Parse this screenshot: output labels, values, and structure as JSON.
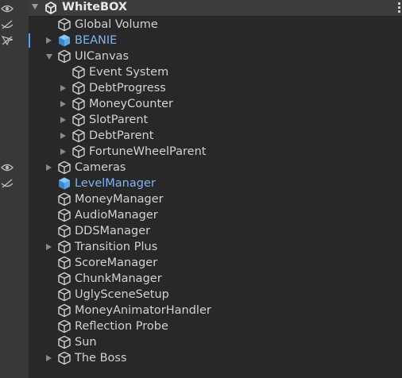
{
  "scene": {
    "title": "WhiteBOX"
  },
  "colors": {
    "background": "#282828",
    "gutter": "#383838",
    "prefab_text": "#7fb4f0",
    "text": "#d2d2d2"
  },
  "items": [
    {
      "label": "Global Volume",
      "depth": 1,
      "foldout": "none",
      "kind": "object"
    },
    {
      "label": "BEANIE",
      "depth": 1,
      "foldout": "closed",
      "kind": "prefab"
    },
    {
      "label": "UICanvas",
      "depth": 1,
      "foldout": "open",
      "kind": "object"
    },
    {
      "label": "Event System",
      "depth": 2,
      "foldout": "none",
      "kind": "object"
    },
    {
      "label": "DebtProgress",
      "depth": 2,
      "foldout": "closed",
      "kind": "object"
    },
    {
      "label": "MoneyCounter",
      "depth": 2,
      "foldout": "closed",
      "kind": "object"
    },
    {
      "label": "SlotParent",
      "depth": 2,
      "foldout": "closed",
      "kind": "object"
    },
    {
      "label": "DebtParent",
      "depth": 2,
      "foldout": "closed",
      "kind": "object"
    },
    {
      "label": "FortuneWheelParent",
      "depth": 2,
      "foldout": "closed",
      "kind": "object"
    },
    {
      "label": "Cameras",
      "depth": 1,
      "foldout": "closed",
      "kind": "object"
    },
    {
      "label": "LevelManager",
      "depth": 1,
      "foldout": "none",
      "kind": "prefab"
    },
    {
      "label": "MoneyManager",
      "depth": 1,
      "foldout": "none",
      "kind": "object"
    },
    {
      "label": "AudioManager",
      "depth": 1,
      "foldout": "none",
      "kind": "object"
    },
    {
      "label": "DDSManager",
      "depth": 1,
      "foldout": "none",
      "kind": "object"
    },
    {
      "label": "Transition Plus",
      "depth": 1,
      "foldout": "closed",
      "kind": "object"
    },
    {
      "label": "ScoreManager",
      "depth": 1,
      "foldout": "none",
      "kind": "object"
    },
    {
      "label": "ChunkManager",
      "depth": 1,
      "foldout": "none",
      "kind": "object"
    },
    {
      "label": "UglySceneSetup",
      "depth": 1,
      "foldout": "none",
      "kind": "object"
    },
    {
      "label": "MoneyAnimatorHandler",
      "depth": 1,
      "foldout": "none",
      "kind": "object"
    },
    {
      "label": "Reflection Probe",
      "depth": 1,
      "foldout": "none",
      "kind": "object"
    },
    {
      "label": "Sun",
      "depth": 1,
      "foldout": "none",
      "kind": "object"
    },
    {
      "label": "The Boss",
      "depth": 1,
      "foldout": "closed",
      "kind": "object"
    }
  ],
  "gutter_icons": [
    {
      "row": -1,
      "icon": "visibility-icon"
    },
    {
      "row": 0,
      "icon": "hidden-icon"
    },
    {
      "row": 1,
      "icon": "pick-disabled-icon"
    },
    {
      "row": 9,
      "icon": "visibility-icon"
    },
    {
      "row": 10,
      "icon": "hidden-icon"
    }
  ]
}
